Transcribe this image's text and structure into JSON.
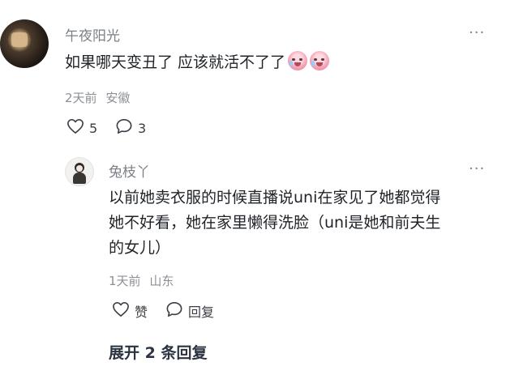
{
  "comment": {
    "username": "午夜阳光",
    "text": "如果哪天变丑了 应该就活不了了",
    "emojis": [
      "crying-face-emoji",
      "crying-face-emoji"
    ],
    "time": "2天前",
    "location": "安徽",
    "likes": "5",
    "replies": "3",
    "more_label": "···"
  },
  "reply": {
    "username": "兔枝丫",
    "text_lines": [
      "以前她卖衣服的时候直播说uni在家见了她都觉得",
      "她不好看，她在家里懒得洗脸（uni是她和前夫生",
      "的女儿）"
    ],
    "time": "1天前",
    "location": "山东",
    "like_label": "赞",
    "reply_label": "回复",
    "more_label": "···"
  },
  "expand_label": "展开 2 条回复"
}
